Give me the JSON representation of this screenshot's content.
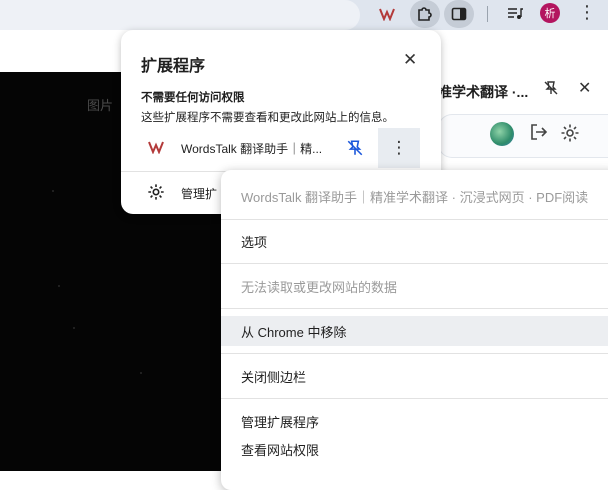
{
  "browser": {
    "avatar_initial": "析",
    "toolbar_icons": [
      "wordstalk-icon",
      "puzzle-icon",
      "sidepanel-icon",
      "reading-list-icon",
      "profile-avatar",
      "more-vert-icon"
    ]
  },
  "page": {
    "tab_label": "图片"
  },
  "side_panel": {
    "title": "准学术翻译 ·..."
  },
  "extensions_popup": {
    "title": "扩展程序",
    "section_title": "不需要任何访问权限",
    "section_desc": "这些扩展程序不需要查看和更改此网站上的信息。",
    "extension_name": "WordsTalk 翻译助手｜精...",
    "manage_label": "管理扩"
  },
  "context_menu": {
    "header": "WordsTalk 翻译助手｜精准学术翻译 · 沉浸式网页 · PDF阅读",
    "items": [
      {
        "label": "选项",
        "enabled": true
      },
      {
        "label": "无法读取或更改网站的数据",
        "enabled": false
      },
      {
        "label": "从 Chrome 中移除",
        "enabled": true
      },
      {
        "label": "关闭侧边栏",
        "enabled": true
      },
      {
        "label": "管理扩展程序",
        "enabled": true
      },
      {
        "label": "查看网站权限",
        "enabled": true
      }
    ]
  },
  "colors": {
    "accent": "#b3155f",
    "toolbar_bg": "#dfe5ee",
    "disabled_text": "#9a9a9a"
  }
}
